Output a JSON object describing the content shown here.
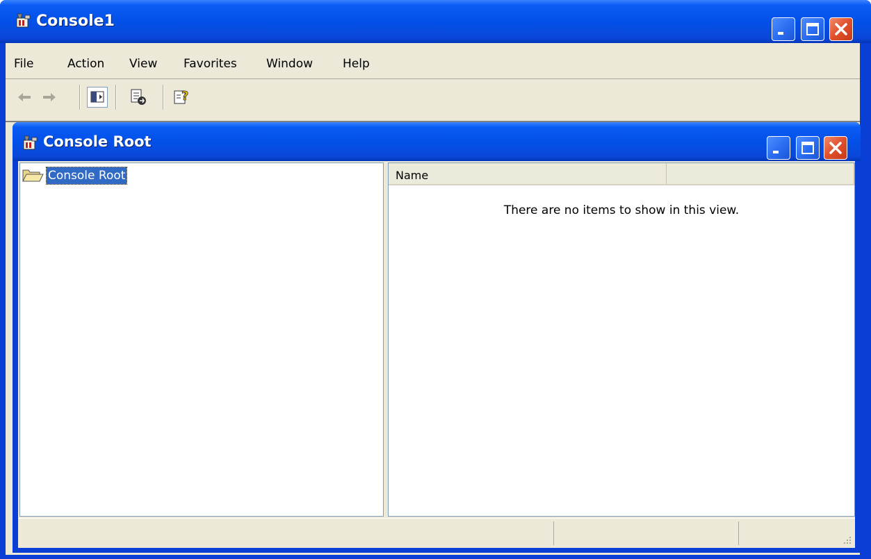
{
  "window": {
    "title": "Console1",
    "icon": "mmc-console-icon"
  },
  "menu": {
    "items": [
      {
        "label": "File"
      },
      {
        "label": "Action"
      },
      {
        "label": "View"
      },
      {
        "label": "Favorites"
      },
      {
        "label": "Window"
      },
      {
        "label": "Help"
      }
    ]
  },
  "toolbar": {
    "buttons": [
      {
        "icon": "back-arrow-icon",
        "enabled": false
      },
      {
        "icon": "forward-arrow-icon",
        "enabled": false
      },
      {
        "icon": "show-hide-console-tree-icon",
        "pressed": true
      },
      {
        "icon": "export-list-icon"
      },
      {
        "icon": "help-icon"
      }
    ]
  },
  "child_window": {
    "title": "Console Root"
  },
  "tree": {
    "root_label": "Console Root",
    "root_icon": "folder-open-icon",
    "selected": true
  },
  "list": {
    "columns": [
      {
        "label": "Name"
      },
      {
        "label": ""
      }
    ],
    "empty_message": "There are no items to show in this view."
  },
  "colors": {
    "titlebar": "#0350e8",
    "selection": "#316ac5",
    "chrome": "#ece9d8",
    "close_button": "#e0502b"
  }
}
